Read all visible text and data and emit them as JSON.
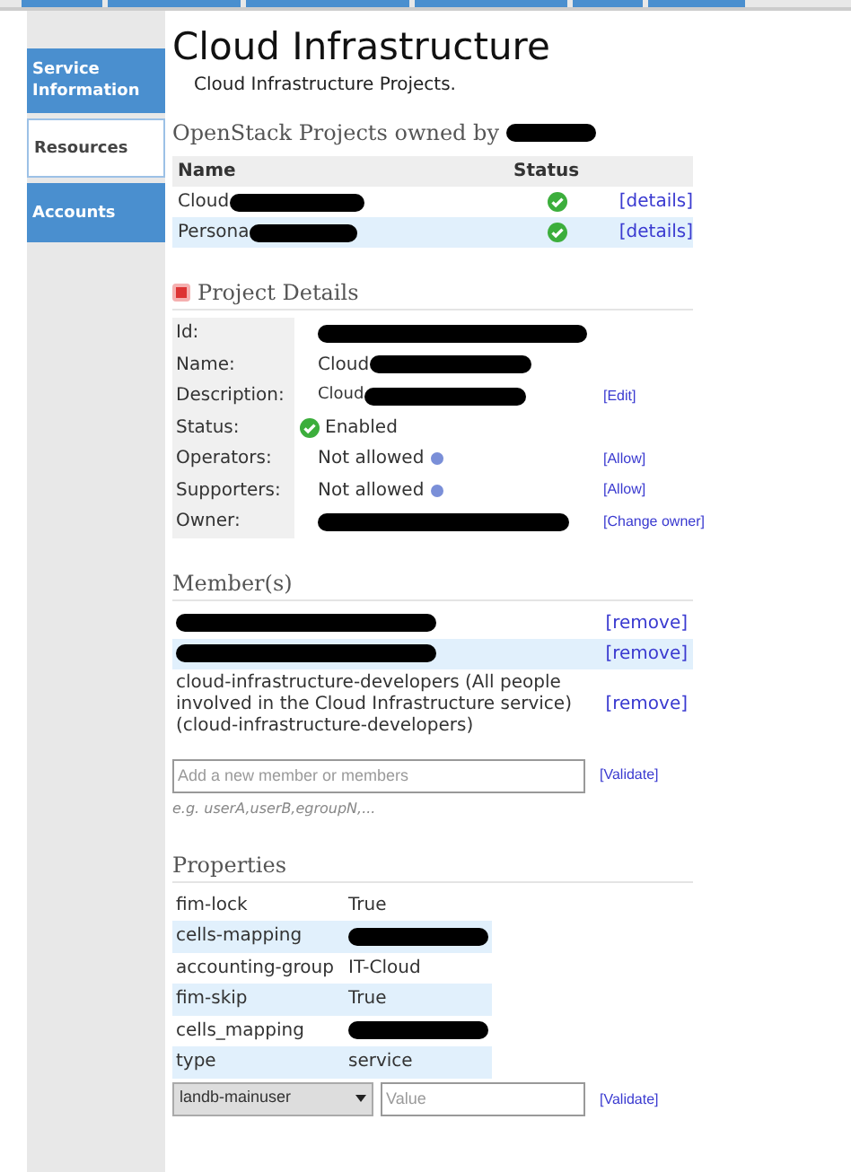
{
  "sidebar": {
    "items": [
      {
        "label": "Service Information",
        "selected": false
      },
      {
        "label": "Resources",
        "selected": true
      },
      {
        "label": "Accounts",
        "selected": false
      }
    ]
  },
  "page": {
    "title": "Cloud Infrastructure",
    "subtitle": "Cloud Infrastructure Projects."
  },
  "projects": {
    "heading": "OpenStack Projects owned by",
    "heading_redacted": true,
    "columns": [
      "Name",
      "Status"
    ],
    "rows": [
      {
        "name": "Cloud",
        "redacted": true,
        "enabled": true,
        "link": "[details]"
      },
      {
        "name": "Persona",
        "redacted": true,
        "enabled": true,
        "link": "[details]"
      }
    ]
  },
  "project_details": {
    "heading": "Project Details",
    "rows": [
      {
        "label": "Id:",
        "kind": "text",
        "redacted": true
      },
      {
        "label": "Name:",
        "kind": "text",
        "value": "Cloud",
        "redacted": true
      },
      {
        "label": "Description:",
        "kind": "small",
        "value": "Cloud",
        "redacted": true,
        "action": "[Edit]"
      },
      {
        "label": "Status:",
        "kind": "status",
        "value": "Enabled",
        "redacted": false
      },
      {
        "label": "Operators:",
        "kind": "info",
        "value": "Not allowed",
        "redacted": false,
        "action": "[Allow]"
      },
      {
        "label": "Supporters:",
        "kind": "info",
        "value": "Not allowed",
        "redacted": false,
        "action": "[Allow]"
      },
      {
        "label": "Owner:",
        "kind": "text",
        "redacted": true,
        "action": "[Change owner]"
      }
    ]
  },
  "members": {
    "heading": "Member(s)",
    "rows": [
      {
        "redacted": true,
        "link": "[remove]"
      },
      {
        "redacted": true,
        "link": "[remove]"
      },
      {
        "text": "cloud-infrastructure-developers (All people involved in the Cloud Infrastructure service) (cloud-infrastructure-developers)",
        "redacted": false,
        "link": "[remove]"
      }
    ],
    "input": {
      "placeholder": "Add a new member or members"
    },
    "validate": "[Validate]",
    "hint": "e.g. userA,userB,egroupN,..."
  },
  "properties": {
    "heading": "Properties",
    "rows": [
      {
        "key": "fim-lock",
        "value": "True",
        "redacted": false
      },
      {
        "key": "cells-mapping",
        "redacted": true
      },
      {
        "key": "accounting-group",
        "value": "IT-Cloud",
        "redacted": false
      },
      {
        "key": "fim-skip",
        "value": "True",
        "redacted": false
      },
      {
        "key": "cells_mapping",
        "redacted": true
      },
      {
        "key": "type",
        "value": "service",
        "redacted": false
      }
    ],
    "select": {
      "value": "landb-mainuser"
    },
    "input": {
      "placeholder": "Value"
    },
    "validate": "[Validate]"
  }
}
